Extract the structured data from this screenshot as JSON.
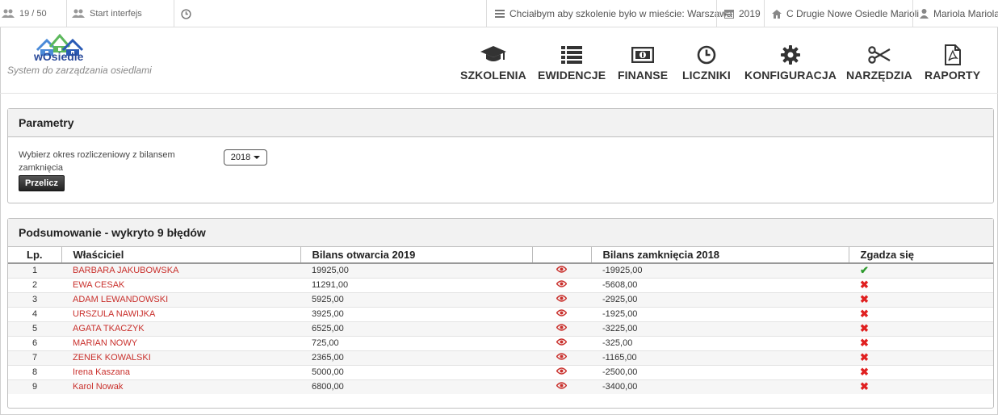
{
  "topbar": {
    "counter": "19 / 50",
    "start": "Start interfejs",
    "training_city": "Chciałbym aby szkolenie było w mieście: Warszawa",
    "year": "2019",
    "estate": "C Drugie Nowe Osiedle Marioli",
    "user": "Mariola Mariola"
  },
  "brand": {
    "logo_text": "wOsiedle",
    "tagline": "System do zarządzania osiedlami"
  },
  "nav": [
    {
      "label": "SZKOLENIA",
      "icon": "graduation-cap-icon"
    },
    {
      "label": "EWIDENCJE",
      "icon": "list-icon"
    },
    {
      "label": "FINANSE",
      "icon": "money-icon"
    },
    {
      "label": "LICZNIKI",
      "icon": "clock-icon"
    },
    {
      "label": "KONFIGURACJA",
      "icon": "gear-icon"
    },
    {
      "label": "NARZĘDZIA",
      "icon": "scissors-icon"
    },
    {
      "label": "RAPORTY",
      "icon": "pdf-file-icon"
    }
  ],
  "params": {
    "title": "Parametry",
    "label": "Wybierz okres rozliczeniowy z bilansem zamknięcia",
    "year_selected": "2018",
    "button": "Przelicz"
  },
  "summary": {
    "title": "Podsumowanie - wykryto 9 błędów",
    "columns": [
      "Lp.",
      "Właściciel",
      "Bilans otwarcia 2019",
      "",
      "Bilans zamknięcia 2018",
      "Zgadza się"
    ],
    "rows": [
      {
        "lp": "1",
        "owner": "BARBARA JAKUBOWSKA",
        "open": "19925,00",
        "close": "-19925,00",
        "ok": true
      },
      {
        "lp": "2",
        "owner": "EWA CESAK",
        "open": "11291,00",
        "close": "-5608,00",
        "ok": false
      },
      {
        "lp": "3",
        "owner": "ADAM LEWANDOWSKI",
        "open": "5925,00",
        "close": "-2925,00",
        "ok": false
      },
      {
        "lp": "4",
        "owner": "URSZULA NAWIJKA",
        "open": "3925,00",
        "close": "-1925,00",
        "ok": false
      },
      {
        "lp": "5",
        "owner": "AGATA TKACZYK",
        "open": "6525,00",
        "close": "-3225,00",
        "ok": false
      },
      {
        "lp": "6",
        "owner": "MARIAN NOWY",
        "open": "725,00",
        "close": "-325,00",
        "ok": false
      },
      {
        "lp": "7",
        "owner": "ZENEK KOWALSKI",
        "open": "2365,00",
        "close": "-1165,00",
        "ok": false
      },
      {
        "lp": "8",
        "owner": "Irena Kaszana",
        "open": "5000,00",
        "close": "-2500,00",
        "ok": false
      },
      {
        "lp": "9",
        "owner": "Karol Nowak",
        "open": "6800,00",
        "close": "-3400,00",
        "ok": false
      }
    ]
  },
  "colors": {
    "owner_link": "#c9302c",
    "check": "#2e9b2e",
    "cross": "#e02020"
  }
}
